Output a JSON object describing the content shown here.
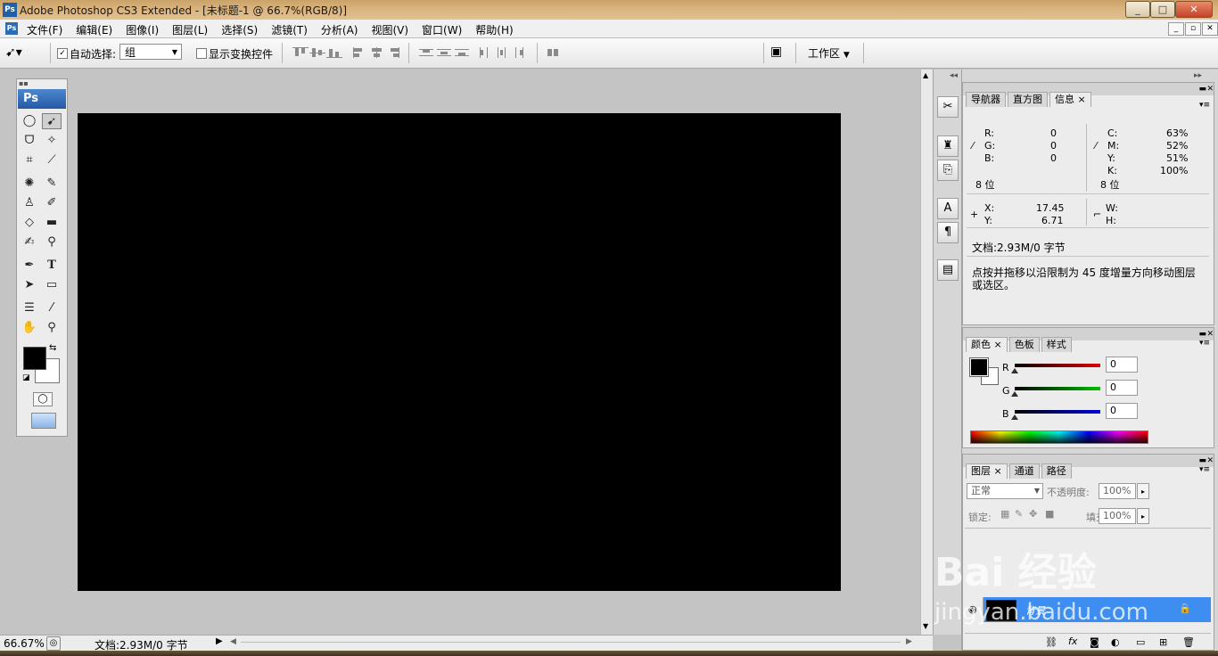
{
  "window": {
    "title": "Adobe Photoshop CS3 Extended - [未标题-1 @ 66.7%(RGB/8)]",
    "app_icon": "Ps",
    "controls": [
      "_",
      "□",
      "✕"
    ]
  },
  "menu": {
    "icon": "Ps",
    "items": [
      "文件(F)",
      "编辑(E)",
      "图像(I)",
      "图层(L)",
      "选择(S)",
      "滤镜(T)",
      "分析(A)",
      "视图(V)",
      "窗口(W)",
      "帮助(H)"
    ],
    "doc_controls": [
      "_",
      "▫",
      "✕"
    ]
  },
  "options": {
    "auto_select_label": "自动选择:",
    "auto_select_checked": true,
    "auto_select_value": "组",
    "show_transform_label": "显示变换控件",
    "show_transform_checked": false,
    "workspace_label": "工作区"
  },
  "toolbox": {
    "header": "Ps",
    "foreground_color": "#000000",
    "background_color": "#ffffff"
  },
  "canvas": {
    "fill": "#000000"
  },
  "status": {
    "zoom": "66.67%",
    "doc_info": "文档:2.93M/0 字节"
  },
  "info_panel": {
    "tabs": [
      "导航器",
      "直方图",
      "信息"
    ],
    "active_tab": "信息",
    "rgb": {
      "r_label": "R:",
      "r": "0",
      "g_label": "G:",
      "g": "0",
      "b_label": "B:",
      "b": "0",
      "bits": "8 位"
    },
    "cmyk": {
      "c_label": "C:",
      "c": "63%",
      "m_label": "M:",
      "m": "52%",
      "y_label": "Y:",
      "y": "51%",
      "k_label": "K:",
      "k": "100%",
      "bits": "8 位"
    },
    "pos": {
      "x_label": "X:",
      "x": "17.45",
      "y_label": "Y:",
      "y": "6.71"
    },
    "size": {
      "w_label": "W:",
      "h_label": "H:"
    },
    "doc": "文档:2.93M/0 字节",
    "hint": "点按并拖移以沿限制为 45 度增量方向移动图层或选区。"
  },
  "color_panel": {
    "tabs": [
      "颜色",
      "色板",
      "样式"
    ],
    "active_tab": "颜色",
    "r_label": "R",
    "r": "0",
    "g_label": "G",
    "g": "0",
    "b_label": "B",
    "b": "0"
  },
  "layers_panel": {
    "tabs": [
      "图层",
      "通道",
      "路径"
    ],
    "active_tab": "图层",
    "blend_mode": "正常",
    "opacity_label": "不透明度:",
    "opacity": "100%",
    "lock_label": "锁定:",
    "fill_label": "填充:",
    "fill": "100%",
    "layer_name": "背景"
  },
  "watermark": {
    "text": "Bai 经验",
    "url": "jingyan.baidu.com"
  }
}
